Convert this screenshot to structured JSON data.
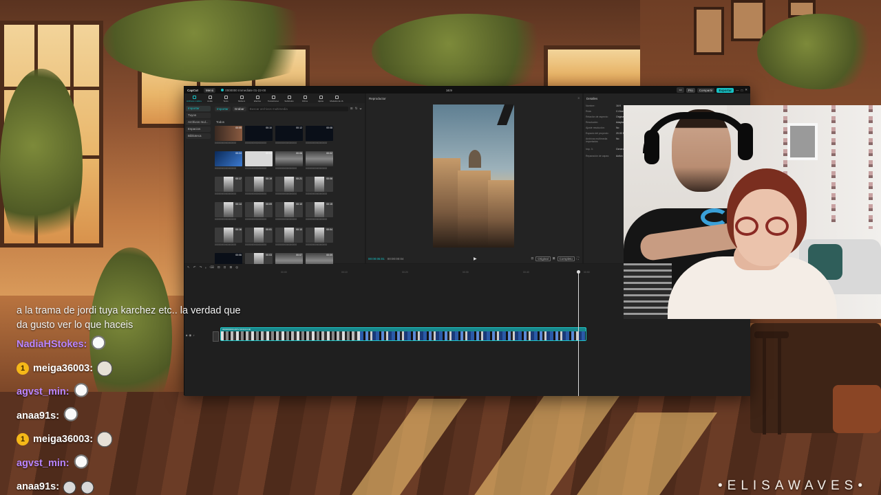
{
  "editor": {
    "app_name": "CapCut",
    "menu_label": "Menú",
    "project_title": "0000000 Immediate 01-22-00",
    "aspect_ratio": "16:9",
    "pro_label": "Pro",
    "share_label": "Compartir",
    "export_label": "Exportar",
    "window_controls": [
      "—",
      "□",
      "✕"
    ],
    "tools": [
      {
        "label": "Archivos multimedia",
        "icon": "media-icon",
        "active": true
      },
      {
        "label": "Audio",
        "icon": "audio-icon"
      },
      {
        "label": "Texto",
        "icon": "text-icon"
      },
      {
        "label": "Stickers",
        "icon": "sticker-icon"
      },
      {
        "label": "Efectos",
        "icon": "effects-icon"
      },
      {
        "label": "Transiciones",
        "icon": "transition-icon"
      },
      {
        "label": "Subtítulos",
        "icon": "captions-icon"
      },
      {
        "label": "Filtros",
        "icon": "filter-icon"
      },
      {
        "label": "Ajuste",
        "icon": "adjust-icon"
      },
      {
        "label": "Modelos de IA",
        "icon": "ai-icon"
      }
    ],
    "sidebar": [
      "Importar",
      "Tuyos",
      "Archivos mul...",
      "Espacios",
      "Biblioteca"
    ],
    "import_label": "Importar",
    "record_label": "Grabar",
    "search_placeholder": "Buscar archivos multimedia",
    "folder_label": "Todos",
    "media": [
      {
        "dur": "00:05",
        "name": "0000000000000000",
        "tone": "warm"
      },
      {
        "dur": "00:10",
        "name": "0000000000000000",
        "tone": "dark"
      },
      {
        "dur": "00:12",
        "name": "0000000000000000",
        "tone": "dark"
      },
      {
        "dur": "00:08",
        "name": "0000000000000000",
        "tone": "dark"
      },
      {
        "dur": "00:24",
        "name": "0000000000000000",
        "tone": "blue"
      },
      {
        "dur": "00:04",
        "name": "0000000000000000",
        "tone": "white"
      },
      {
        "dur": "00:06",
        "name": "0000000000000000",
        "tone": "street"
      },
      {
        "dur": "00:02",
        "name": "0000000000000000",
        "tone": "street"
      },
      {
        "dur": "00:17",
        "name": "0000000000000000",
        "tone": "portrait"
      },
      {
        "dur": "00:19",
        "name": "0000000000000000",
        "tone": "portrait"
      },
      {
        "dur": "00:21",
        "name": "0000000000000000",
        "tone": "portrait"
      },
      {
        "dur": "00:06",
        "name": "0000000000000000",
        "tone": "portrait"
      },
      {
        "dur": "00:14",
        "name": "0000000000000000",
        "tone": "portrait"
      },
      {
        "dur": "00:09",
        "name": "0000000000000000",
        "tone": "portrait"
      },
      {
        "dur": "00:10",
        "name": "0000000000000000",
        "tone": "portrait"
      },
      {
        "dur": "00:15",
        "name": "0000000000000000",
        "tone": "portrait"
      },
      {
        "dur": "00:16",
        "name": "0000000000000000",
        "tone": "portrait"
      },
      {
        "dur": "00:01",
        "name": "0000000000000000",
        "tone": "portrait"
      },
      {
        "dur": "00:10",
        "name": "0000000000000000",
        "tone": "portrait"
      },
      {
        "dur": "00:04",
        "name": "0000000000000000",
        "tone": "portrait"
      },
      {
        "dur": "00:06",
        "name": "0000000000000000",
        "tone": "dark"
      },
      {
        "dur": "00:03",
        "name": "0000000000000000",
        "tone": "portrait"
      },
      {
        "dur": "00:07",
        "name": "0000000000000000",
        "tone": "street"
      },
      {
        "dur": "00:09",
        "name": "0000000000000000",
        "tone": "street"
      }
    ],
    "player": {
      "title": "Reproductor",
      "current_time": "00:00:05:01",
      "total_time": "00:00:00:04",
      "ratio_label": "Original",
      "quality_label": "Completo"
    },
    "details": {
      "title": "Detalles",
      "rows": [
        {
          "key": "Nombre:",
          "value": "16:9"
        },
        {
          "key": "Ruta:",
          "value": "C:/Users"
        },
        {
          "key": "Relación de aspecto:",
          "value": "Original"
        },
        {
          "key": "Resolución:",
          "value": "Adaptado"
        },
        {
          "key": "Ajuste resolución:",
          "value": "No"
        },
        {
          "key": "Espacio del proyecto:",
          "value": "20.00 B"
        },
        {
          "key": "Archivos multimedia importados:",
          "value": "No"
        },
        {
          "key": "Imp. 3:",
          "value": "General"
        },
        {
          "key": "Reparación de capas:",
          "value": "Activo"
        }
      ]
    },
    "timeline": {
      "tools": [
        "↖",
        "↶",
        "↷",
        "⟊",
        "⌫",
        "⊟",
        "⊡",
        "⊞",
        "◎"
      ],
      "ticks": [
        "00:00",
        "00:10",
        "00:20",
        "00:30",
        "00:40",
        "00:50"
      ],
      "cover_label": "Portada",
      "clip_label": "0000000000.MOV  00:00:04:00"
    }
  },
  "chat": {
    "partial_message": "a la trama de jordi tuya karchez etc.. la verdad que da gusto ver lo que haceis",
    "messages": [
      {
        "user": "NadiaHStokes",
        "color": "purple",
        "badge": null,
        "emotes": [
          "goose"
        ]
      },
      {
        "user": "meiga36003",
        "color": "white",
        "badge": "1",
        "emotes": [
          "horse"
        ]
      },
      {
        "user": "agvst_min",
        "color": "purple",
        "badge": null,
        "emotes": [
          "goose"
        ]
      },
      {
        "user": "anaa91s",
        "color": "white",
        "badge": null,
        "emotes": [
          "goose"
        ]
      },
      {
        "user": "meiga36003",
        "color": "white",
        "badge": "1",
        "emotes": [
          "horse"
        ]
      },
      {
        "user": "agvst_min",
        "color": "purple",
        "badge": null,
        "emotes": [
          "goose"
        ]
      },
      {
        "user": "anaa91s",
        "color": "white",
        "badge": null,
        "emotes": [
          "cat",
          "cat"
        ]
      }
    ]
  },
  "watermark": "•ELISAWAVES•"
}
